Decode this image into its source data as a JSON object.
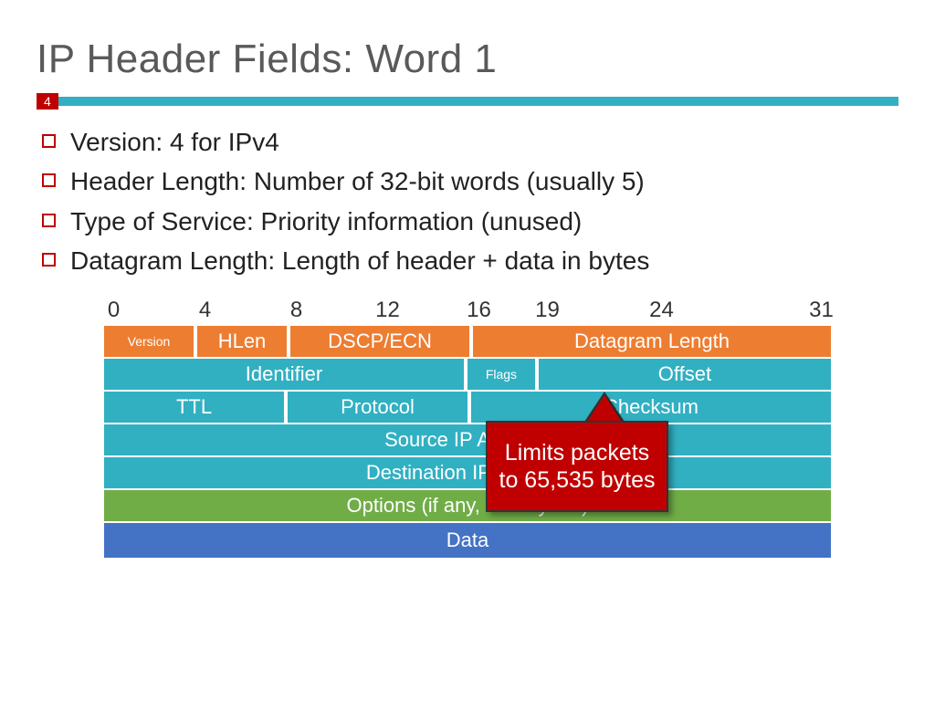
{
  "title": "IP Header Fields: Word 1",
  "page_number": "4",
  "bullets": [
    "Version: 4 for IPv4",
    "Header Length: Number of 32-bit words (usually 5)",
    "Type of Service: Priority information (unused)",
    "Datagram Length: Length of header + data in bytes"
  ],
  "bit_ticks": [
    {
      "label": "0",
      "pos": 0
    },
    {
      "label": "4",
      "pos": 4
    },
    {
      "label": "8",
      "pos": 8
    },
    {
      "label": "12",
      "pos": 12
    },
    {
      "label": "16",
      "pos": 16
    },
    {
      "label": "19",
      "pos": 19
    },
    {
      "label": "24",
      "pos": 24
    },
    {
      "label": "31",
      "pos": 31
    }
  ],
  "rows": {
    "r0": {
      "version": "Version",
      "hlen": "HLen",
      "dscp": "DSCP/ECN",
      "dglen": "Datagram Length"
    },
    "r1": {
      "ident": "Identifier",
      "flags": "Flags",
      "offset": "Offset"
    },
    "r2": {
      "ttl": "TTL",
      "proto": "Protocol",
      "cksum": "Checksum"
    },
    "r3": {
      "src": "Source IP Address"
    },
    "r4": {
      "dst": "Destination IP Address"
    },
    "r5": {
      "opts": "Options (if any, usually not)"
    },
    "r6": {
      "data": "Data"
    }
  },
  "callout": "Limits packets to 65,535 bytes",
  "colors": {
    "orange": "#ed7d31",
    "teal": "#31b0c2",
    "green": "#70ad47",
    "blue": "#4472c4",
    "red": "#c00000"
  }
}
